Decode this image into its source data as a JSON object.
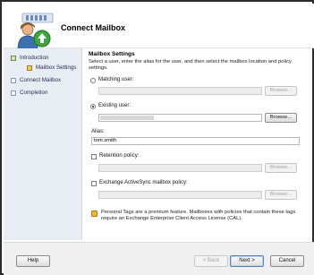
{
  "wizard": {
    "title": "Connect Mailbox"
  },
  "nav": {
    "items": [
      {
        "label": "Introduction",
        "state": "done",
        "sub": false
      },
      {
        "label": "Mailbox Settings",
        "state": "current",
        "sub": true
      },
      {
        "label": "Connect Mailbox",
        "state": "pending",
        "sub": false
      },
      {
        "label": "Completion",
        "state": "pending",
        "sub": false
      }
    ]
  },
  "settings": {
    "heading": "Mailbox Settings",
    "description": "Select a user, enter the alias for the user, and then select the mailbox location and policy settings.",
    "matching_user_label": "Matching user:",
    "matching_user_value": "",
    "existing_user_label": "Existing user:",
    "existing_user_value": "",
    "selected_option": "existing_user",
    "browse_label": "Browse...",
    "alias_label": "Alias:",
    "alias_value": "tom.smith",
    "retention_label": "Retention policy:",
    "retention_checked": false,
    "activesync_label": "Exchange ActiveSync mailbox policy:",
    "activesync_checked": false,
    "info_text": "Personal Tags are a premium feature. Mailboxes with policies that contain these tags require an Exchange Enterprise Client Access License (CAL)."
  },
  "footer": {
    "help": "Help",
    "back": "< Back",
    "next": "Next >",
    "cancel": "Cancel"
  },
  "icons": {
    "wizard": "users-green-arrow-icon",
    "info": "info-icon"
  }
}
